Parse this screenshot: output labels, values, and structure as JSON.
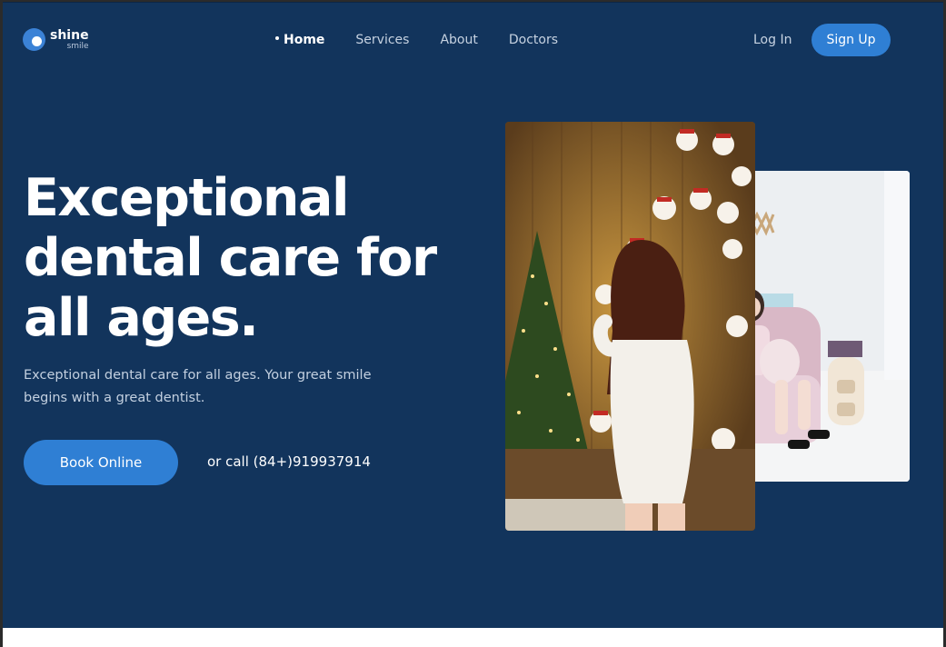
{
  "brand": {
    "name": "shine",
    "sub": "smile"
  },
  "nav": {
    "items": [
      "Home",
      "Services",
      "About",
      "Doctors"
    ],
    "active": "Home"
  },
  "auth": {
    "login": "Log In",
    "signup": "Sign Up"
  },
  "hero": {
    "headline_lines": [
      "Exceptional",
      "dental care for",
      "all ages."
    ],
    "subtext_lines": [
      "Exceptional dental care for all ages. Your great smile",
      "begins with a great dentist."
    ],
    "book_label": "Book Online",
    "call_text": "or call (84+)919937914"
  },
  "colors": {
    "hero_bg": "#12345c",
    "accent": "#2f7fd4",
    "text_primary": "#ffffff",
    "text_muted": "#c3d0e0"
  },
  "images": [
    {
      "name": "christmas-photo",
      "description_icon": "photo-icon"
    },
    {
      "name": "room-photo",
      "description_icon": "photo-icon"
    }
  ]
}
